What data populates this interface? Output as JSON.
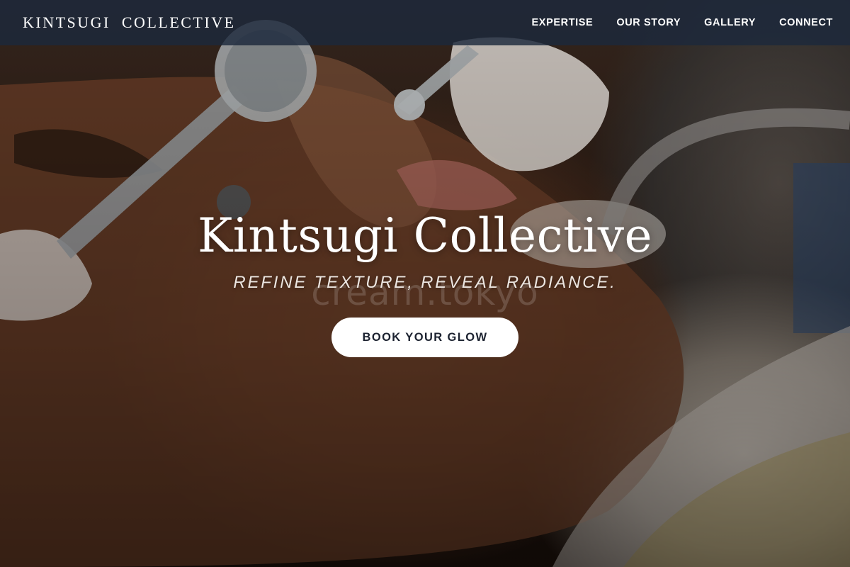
{
  "nav": {
    "brand": "KINTSUGI  COLLECTIVE",
    "links": [
      "EXPERTISE",
      "OUR STORY",
      "GALLERY",
      "CONNECT"
    ]
  },
  "hero": {
    "title": "Kintsugi Collective",
    "tagline": "REFINE TEXTURE, REVEAL RADIANCE.",
    "watermark": "cream.tokyo",
    "cta_label": "BOOK YOUR GLOW",
    "image_alt": "facial-treatment-photo"
  },
  "colors": {
    "nav_bg": "#1c283c",
    "text": "#ffffff",
    "cta_bg": "#ffffff",
    "cta_text": "#1c2230"
  }
}
